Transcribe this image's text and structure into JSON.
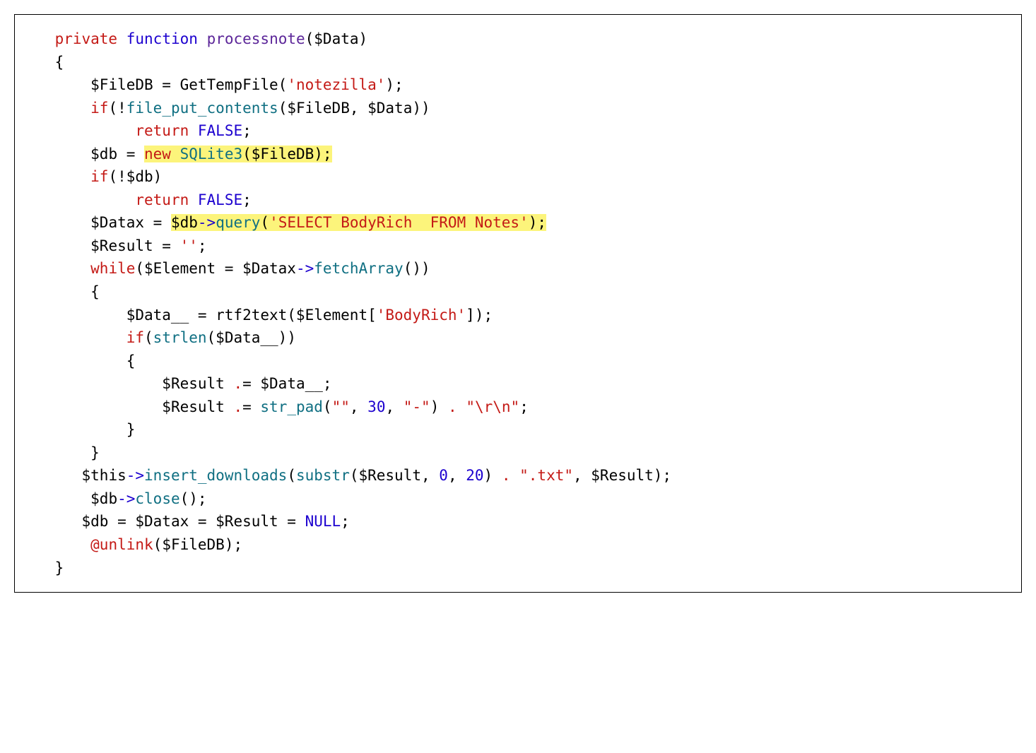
{
  "code": {
    "l01": {
      "kw_private": "private",
      "kw_function": "function",
      "fn": "processnote",
      "args": "($Data)"
    },
    "l02": {
      "brace": "{"
    },
    "l03": {
      "pre": "$FileDB = GetTempFile(",
      "str": "'notezilla'",
      "post": ");"
    },
    "l04": {
      "kw": "if",
      "pre": "(!",
      "fn": "file_put_contents",
      "post": "($FileDB, $Data))"
    },
    "l05": {
      "kw": "return",
      "val": "FALSE",
      "semi": ";"
    },
    "l06": {
      "pre": "$db = ",
      "kw": "new",
      "sp": " ",
      "cls": "SQLite3",
      "post": "($FileDB);"
    },
    "l07": {
      "kw": "if",
      "post": "(!$db)"
    },
    "l08": {
      "kw": "return",
      "val": "FALSE",
      "semi": ";"
    },
    "l09": {
      "pre": "$Datax = ",
      "obj": "$db",
      "arrow": "->",
      "fn": "query",
      "open": "(",
      "str": "'SELECT BodyRich  FROM Notes'",
      "close": ");"
    },
    "l10": {
      "pre": "$Result = ",
      "str": "''",
      "semi": ";"
    },
    "l11": {
      "kw": "while",
      "pre": "($Element = $Datax",
      "arrow": "->",
      "fn": "fetchArray",
      "post": "())"
    },
    "l12": {
      "brace": "{"
    },
    "l13": {
      "pre": "$Data__ = rtf2text($Element[",
      "str": "'BodyRich'",
      "post": "]);"
    },
    "l14": {
      "kw": "if",
      "open": "(",
      "fn": "strlen",
      "post": "($Data__))"
    },
    "l15": {
      "brace": "{"
    },
    "l16": {
      "pre": "$Result ",
      "op": ".",
      "post": "= $Data__;"
    },
    "l17": {
      "pre": "$Result ",
      "op": ".",
      "eq": "= ",
      "fn": "str_pad",
      "open": "(",
      "s1": "\"\"",
      "c1": ", ",
      "n": "30",
      "c2": ", ",
      "s2": "\"-\"",
      "close": ")",
      "sp1": " ",
      "dot": ".",
      "sp2": " ",
      "s3": "\"\\r\\n\"",
      "semi": ";"
    },
    "l18": {
      "brace": "}"
    },
    "l19": {
      "brace": "}"
    },
    "l20": {
      "pre": "$this",
      "arrow": "->",
      "fn": "insert_downloads",
      "open": "(",
      "sub": "substr",
      "args1": "($Result, ",
      "n1": "0",
      "c1": ", ",
      "n2": "20",
      "close1": ") ",
      "dot": ".",
      "sp": " ",
      "str": "\".txt\"",
      "post": ", $Result);"
    },
    "l21": {
      "pre": " $db",
      "arrow": "->",
      "fn": "close",
      "post": "();"
    },
    "l22": {
      "pre": "$db = $Datax = $Result = ",
      "val": "NULL",
      "semi": ";"
    },
    "l23": {
      "fn": " @unlink",
      "post": "($FileDB);"
    },
    "l24": {
      "brace": "}"
    }
  }
}
